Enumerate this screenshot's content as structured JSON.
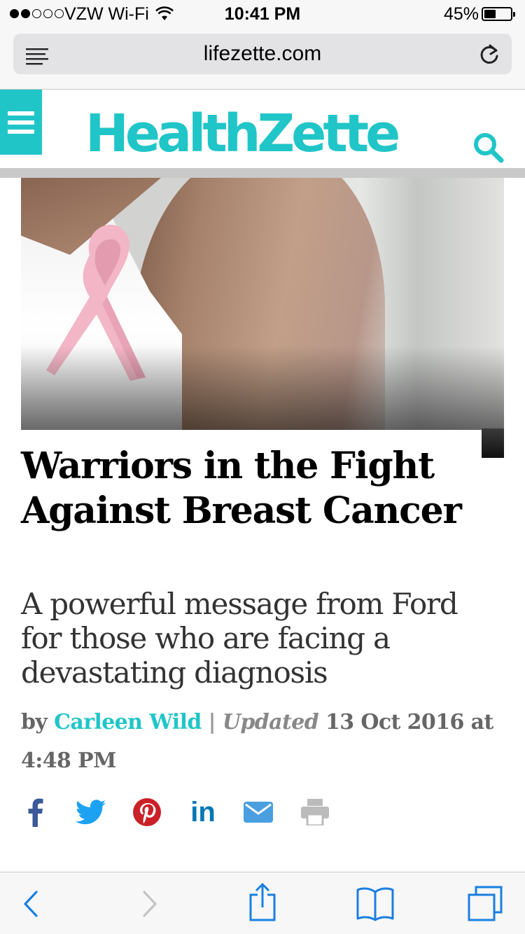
{
  "status_bar": {
    "carrier": "VZW Wi-Fi",
    "time": "10:41 PM",
    "battery_percent": "45%",
    "battery_level": 0.45,
    "signal_bars_filled": 2,
    "signal_bars_total": 5
  },
  "browser": {
    "url": "lifezette.com"
  },
  "site": {
    "logo": "HealthZette",
    "brand_color": "#20c5c8"
  },
  "hero": {
    "icon": "pink-ribbon"
  },
  "article": {
    "title": "Warriors in the Fight Against Breast Cancer",
    "subtitle": "A powerful message from Ford for those who are facing a devastating diagnosis",
    "byline_prefix": "by",
    "author": "Carleen Wild",
    "separator": "|",
    "updated_label": "Updated",
    "date": "13 Oct 2016 at 4:48 PM"
  },
  "share": [
    {
      "name": "facebook-icon",
      "color": "#3b5998"
    },
    {
      "name": "twitter-icon",
      "color": "#1da1f2"
    },
    {
      "name": "pinterest-icon",
      "color": "#cb2027"
    },
    {
      "name": "linkedin-icon",
      "color": "#0077b5"
    },
    {
      "name": "email-icon",
      "color": "#4a9fe0"
    },
    {
      "name": "print-icon",
      "color": "#bbbbbb"
    }
  ],
  "toolbar": {
    "back_enabled": true,
    "forward_enabled": false
  }
}
